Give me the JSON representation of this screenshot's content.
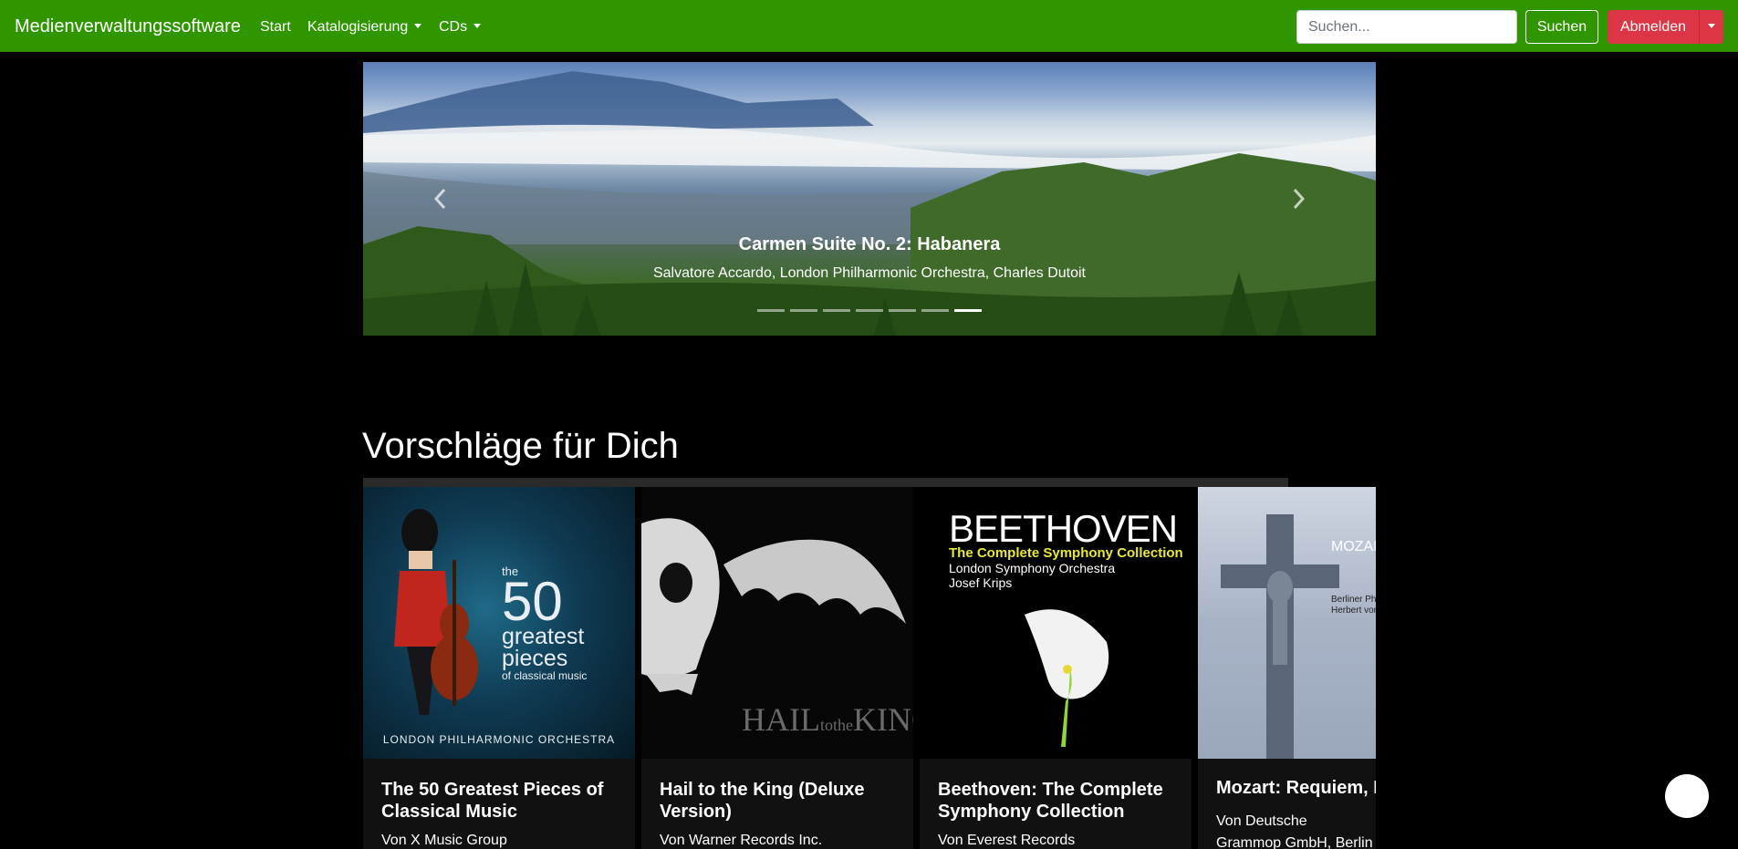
{
  "navbar": {
    "brand": "Medienverwaltungssoftware",
    "links": [
      {
        "label": "Start"
      },
      {
        "label": "Katalogisierung"
      },
      {
        "label": "CDs"
      }
    ],
    "search_placeholder": "Suchen...",
    "search_button": "Suchen",
    "logout_button": "Abmelden",
    "brand_color": "#2f9600",
    "logout_color": "#dc3545"
  },
  "carousel": {
    "title": "Carmen Suite No. 2: Habanera",
    "subtitle": "Salvatore Accardo, London Philharmonic Orchestra, Charles Dutoit",
    "indicator_count": 7,
    "active_index": 6
  },
  "suggestions": {
    "heading": "Vorschläge für Dich",
    "cards": [
      {
        "title": "The 50 Greatest Pieces of Classical Music",
        "label": "Von X Music Group",
        "cover_text": [
          "the",
          "50",
          "greatest",
          "pieces",
          "of classical music",
          "LONDON PHILHARMONIC ORCHESTRA"
        ]
      },
      {
        "title": "Hail to the King (Deluxe Version)",
        "label": "Von Warner Records Inc.",
        "cover_text": [
          "HAIL",
          "to",
          "the",
          "KING"
        ]
      },
      {
        "title": "Beethoven: The Complete Symphony Collection",
        "label": "Von Everest Records",
        "cover_text": [
          "BEETHOVEN",
          "The Complete Symphony Collection",
          "London Symphony Orchestra",
          "Josef Krips"
        ]
      },
      {
        "title": "Mozart: Requiem, K",
        "label": "Von Deutsche Grammop GmbH, Berlin",
        "cover_text": [
          "MOZART ·",
          "Berliner Philharmo",
          "Herbert von Karaja"
        ]
      }
    ]
  }
}
